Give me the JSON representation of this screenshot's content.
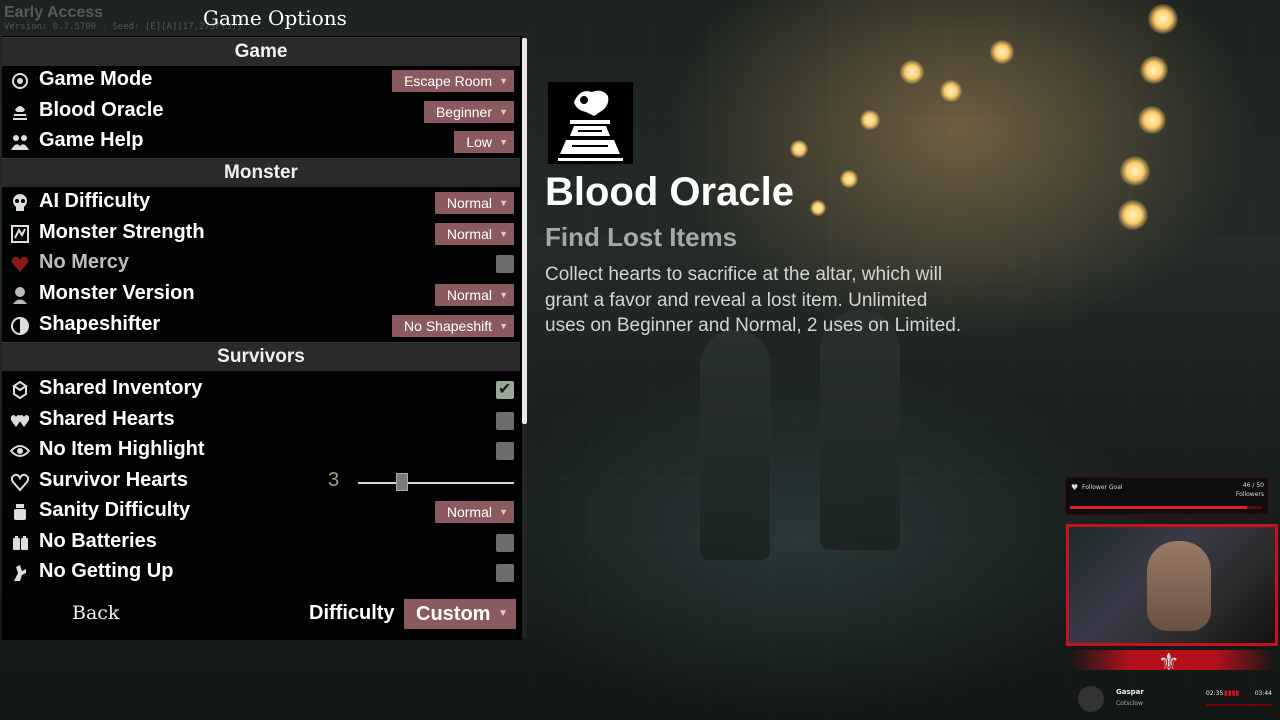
{
  "header": {
    "early_access": "Early Access",
    "version": "Version: 0.7.5700 - Seed: [E][A][17,273F(5)]",
    "title": "Game Options"
  },
  "sections": {
    "game": "Game",
    "monster": "Monster",
    "survivors": "Survivors"
  },
  "options": {
    "game_mode": {
      "label": "Game Mode",
      "value": "Escape Room",
      "icon": "game-mode-icon"
    },
    "blood_oracle": {
      "label": "Blood Oracle",
      "value": "Beginner",
      "icon": "oracle-icon"
    },
    "game_help": {
      "label": "Game Help",
      "value": "Low",
      "icon": "help-icon"
    },
    "ai_difficulty": {
      "label": "AI Difficulty",
      "value": "Normal",
      "icon": "skull-icon"
    },
    "monster_strength": {
      "label": "Monster Strength",
      "value": "Normal",
      "icon": "strength-icon"
    },
    "no_mercy": {
      "label": "No Mercy",
      "checked": false,
      "icon": "heart-icon"
    },
    "monster_version": {
      "label": "Monster Version",
      "value": "Normal",
      "icon": "monster-version-icon"
    },
    "shapeshifter": {
      "label": "Shapeshifter",
      "value": "No Shapeshift",
      "icon": "shapeshifter-icon"
    },
    "shared_inventory": {
      "label": "Shared Inventory",
      "checked": true,
      "icon": "inventory-icon"
    },
    "shared_hearts": {
      "label": "Shared Hearts",
      "checked": false,
      "icon": "hearts-icon"
    },
    "no_item_highlight": {
      "label": "No Item Highlight",
      "checked": false,
      "icon": "eye-icon"
    },
    "survivor_hearts": {
      "label": "Survivor Hearts",
      "value": "3",
      "slider_fraction": 0.28,
      "icon": "survivor-heart-icon"
    },
    "sanity_difficulty": {
      "label": "Sanity Difficulty",
      "value": "Normal",
      "icon": "sanity-icon"
    },
    "no_batteries": {
      "label": "No Batteries",
      "checked": false,
      "icon": "battery-icon"
    },
    "no_getting_up": {
      "label": "No Getting Up",
      "checked": false,
      "icon": "getting-up-icon"
    }
  },
  "footer": {
    "back_label": "Back",
    "difficulty_label": "Difficulty",
    "difficulty_value": "Custom"
  },
  "detail": {
    "icon": "blood-oracle-altar-icon",
    "title": "Blood Oracle",
    "subtitle": "Find Lost Items",
    "description": "Collect hearts to sacrifice at the altar, which will grant a favor and reveal a lost item. Unlimited uses on Beginner and Normal, 2 uses on Limited."
  },
  "stream_overlay": {
    "goal_title": "Follower Goal",
    "goal_count": "46 / 50",
    "goal_unit": "Followers",
    "goal_progress": 0.92,
    "artist": "Gaspar",
    "track": "Cotsclow",
    "time_elapsed": "02:35",
    "time_total": "03:44"
  },
  "colors": {
    "dropdown": "#8b5a5e",
    "stream_accent": "#c4121f",
    "slider_value": "#8ab07a"
  }
}
